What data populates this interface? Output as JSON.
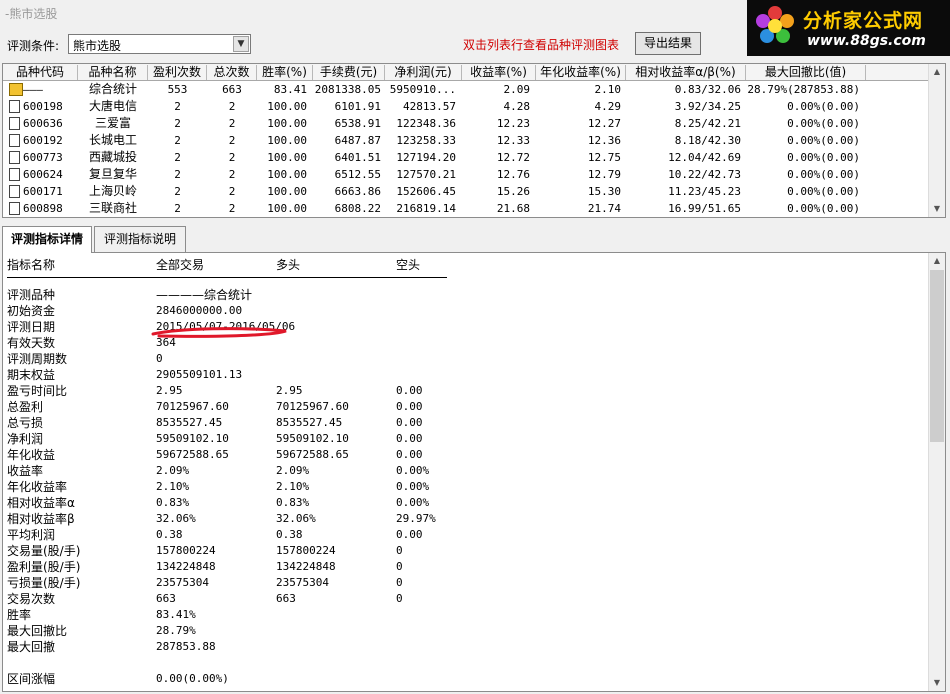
{
  "window": {
    "title": "-熊市选股"
  },
  "logo": {
    "brand": "分析家公式网",
    "url": "www.88gs.com"
  },
  "toolbar": {
    "condition_label": "评测条件:",
    "condition_value": "熊市选股",
    "hint": "双击列表行查看品种评测图表",
    "export_label": "导出结果"
  },
  "grid": {
    "columns": [
      "品种代码",
      "品种名称",
      "盈利次数",
      "总次数",
      "胜率(%)",
      "手续费(元)",
      "净利润(元)",
      "收益率(%)",
      "年化收益率(%)",
      "相对收益率α/β(%)",
      "最大回撤比(值)"
    ],
    "rows": [
      {
        "code": "———",
        "name": "综合统计",
        "wins": "553",
        "total": "663",
        "winrate": "83.41",
        "fee": "2081338.05",
        "profit": "5950910...",
        "ret": "2.09",
        "annual": "2.10",
        "ab": "0.83/32.06",
        "mdd": "28.79%(287853.88)",
        "icon": "summary-icon"
      },
      {
        "code": "600198",
        "name": "大唐电信",
        "wins": "2",
        "total": "2",
        "winrate": "100.00",
        "fee": "6101.91",
        "profit": "42813.57",
        "ret": "4.28",
        "annual": "4.29",
        "ab": "3.92/34.25",
        "mdd": "0.00%(0.00)",
        "icon": "document-icon"
      },
      {
        "code": "600636",
        "name": "三爱富",
        "wins": "2",
        "total": "2",
        "winrate": "100.00",
        "fee": "6538.91",
        "profit": "122348.36",
        "ret": "12.23",
        "annual": "12.27",
        "ab": "8.25/42.21",
        "mdd": "0.00%(0.00)",
        "icon": "document-icon"
      },
      {
        "code": "600192",
        "name": "长城电工",
        "wins": "2",
        "total": "2",
        "winrate": "100.00",
        "fee": "6487.87",
        "profit": "123258.33",
        "ret": "12.33",
        "annual": "12.36",
        "ab": "8.18/42.30",
        "mdd": "0.00%(0.00)",
        "icon": "document-icon"
      },
      {
        "code": "600773",
        "name": "西藏城投",
        "wins": "2",
        "total": "2",
        "winrate": "100.00",
        "fee": "6401.51",
        "profit": "127194.20",
        "ret": "12.72",
        "annual": "12.75",
        "ab": "12.04/42.69",
        "mdd": "0.00%(0.00)",
        "icon": "document-icon"
      },
      {
        "code": "600624",
        "name": "复旦复华",
        "wins": "2",
        "total": "2",
        "winrate": "100.00",
        "fee": "6512.55",
        "profit": "127570.21",
        "ret": "12.76",
        "annual": "12.79",
        "ab": "10.22/42.73",
        "mdd": "0.00%(0.00)",
        "icon": "document-icon"
      },
      {
        "code": "600171",
        "name": "上海贝岭",
        "wins": "2",
        "total": "2",
        "winrate": "100.00",
        "fee": "6663.86",
        "profit": "152606.45",
        "ret": "15.26",
        "annual": "15.30",
        "ab": "11.23/45.23",
        "mdd": "0.00%(0.00)",
        "icon": "document-icon"
      },
      {
        "code": "600898",
        "name": "三联商社",
        "wins": "2",
        "total": "2",
        "winrate": "100.00",
        "fee": "6808.22",
        "profit": "216819.14",
        "ret": "21.68",
        "annual": "21.74",
        "ab": "16.99/51.65",
        "mdd": "0.00%(0.00)",
        "icon": "document-icon"
      }
    ]
  },
  "tabs": [
    {
      "label": "评测指标详情",
      "active": true
    },
    {
      "label": "评测指标说明",
      "active": false
    }
  ],
  "detail": {
    "headers": {
      "name": "指标名称",
      "all": "全部交易",
      "long": "多头",
      "short": "空头"
    },
    "rows": [
      {
        "label": "评测品种",
        "all": "————综合统计",
        "long": "",
        "short": ""
      },
      {
        "label": "初始资金",
        "all": "2846000000.00",
        "long": "",
        "short": ""
      },
      {
        "label": "评测日期",
        "all": "2015/05/07-2016/05/06",
        "long": "",
        "short": ""
      },
      {
        "label": "有效天数",
        "all": "364",
        "long": "",
        "short": ""
      },
      {
        "label": "评测周期数",
        "all": "0",
        "long": "",
        "short": ""
      },
      {
        "label": "期末权益",
        "all": "2905509101.13",
        "long": "",
        "short": ""
      },
      {
        "label": "盈亏时间比",
        "all": "2.95",
        "long": "2.95",
        "short": "0.00"
      },
      {
        "label": "总盈利",
        "all": "70125967.60",
        "long": "70125967.60",
        "short": "0.00"
      },
      {
        "label": "总亏损",
        "all": "8535527.45",
        "long": "8535527.45",
        "short": "0.00"
      },
      {
        "label": "净利润",
        "all": "59509102.10",
        "long": "59509102.10",
        "short": "0.00"
      },
      {
        "label": "年化收益",
        "all": "59672588.65",
        "long": "59672588.65",
        "short": "0.00"
      },
      {
        "label": "收益率",
        "all": "2.09%",
        "long": "2.09%",
        "short": "0.00%"
      },
      {
        "label": "年化收益率",
        "all": "2.10%",
        "long": "2.10%",
        "short": "0.00%"
      },
      {
        "label": "相对收益率α",
        "all": "0.83%",
        "long": " 0.83%",
        "short": " 0.00%"
      },
      {
        "label": "相对收益率β",
        "all": "32.06%",
        "long": " 32.06%",
        "short": " 29.97%"
      },
      {
        "label": "平均利润",
        "all": "0.38",
        "long": "0.38",
        "short": "0.00"
      },
      {
        "label": "交易量(股/手)",
        "all": "157800224",
        "long": "157800224",
        "short": "0"
      },
      {
        "label": "盈利量(股/手)",
        "all": "134224848",
        "long": "134224848",
        "short": "0"
      },
      {
        "label": "亏损量(股/手)",
        "all": "23575304",
        "long": "23575304",
        "short": "0"
      },
      {
        "label": "交易次数",
        "all": "663",
        "long": "663",
        "short": "0"
      },
      {
        "label": "胜率",
        "all": "83.41%",
        "long": "",
        "short": ""
      },
      {
        "label": "最大回撤比",
        "all": "28.79%",
        "long": "",
        "short": ""
      },
      {
        "label": "最大回撤",
        "all": "287853.88",
        "long": "",
        "short": ""
      },
      {
        "label": "",
        "all": "",
        "long": "",
        "short": ""
      },
      {
        "label": "区间涨幅",
        "all": "0.00(0.00%)",
        "long": "",
        "short": ""
      }
    ]
  },
  "colors": {
    "hint": "#d00000",
    "annotation": "#e0182a",
    "logo_bg": "#0b0b0b",
    "logo_text": "#ffcc00"
  }
}
